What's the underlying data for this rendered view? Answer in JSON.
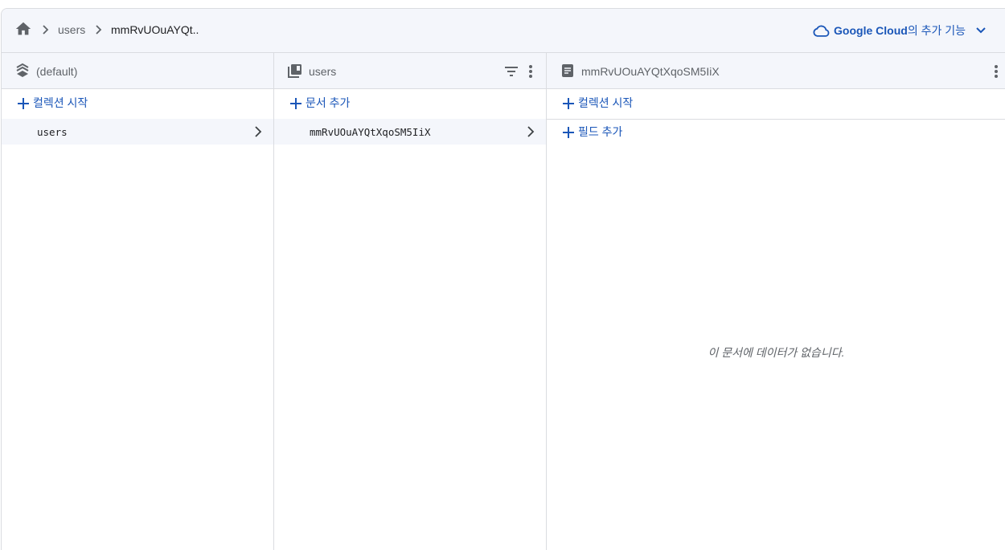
{
  "breadcrumb": {
    "items": [
      "users",
      "mmRvUOuAYQt.."
    ]
  },
  "google_cloud": {
    "brand": "Google Cloud",
    "suffix": "의 추가 기능"
  },
  "panels": {
    "root": {
      "title": "(default)",
      "add_label": "컬렉션 시작",
      "items": [
        "users"
      ]
    },
    "collection": {
      "title": "users",
      "add_label": "문서 추가",
      "items": [
        "mmRvUOuAYQtXqoSM5IiX"
      ]
    },
    "document": {
      "title": "mmRvUOuAYQtXqoSM5IiX",
      "add_collection_label": "컬렉션 시작",
      "add_field_label": "필드 추가",
      "empty_message": "이 문서에 데이터가 없습니다."
    }
  },
  "colors": {
    "accent": "#1a56b8",
    "header_bg": "#f4f6fb",
    "border": "#dadce0"
  }
}
